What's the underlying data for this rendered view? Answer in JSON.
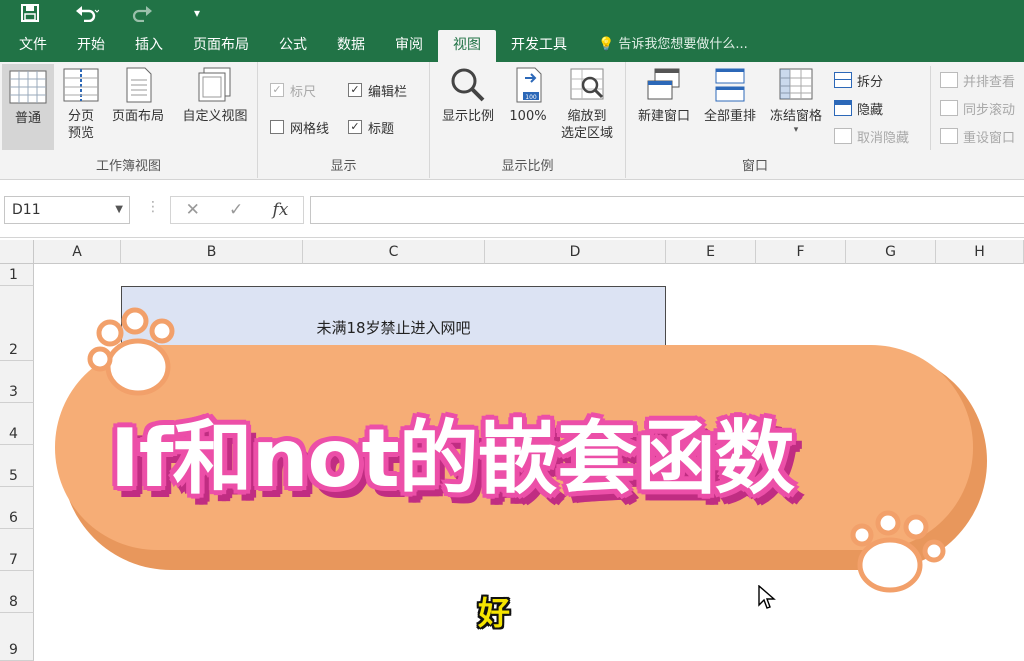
{
  "quick_access": {
    "save_icon": "save-icon",
    "undo_icon": "undo-icon",
    "redo_icon": "redo-icon",
    "customize_icon": "customize-icon"
  },
  "tabs": [
    {
      "label": "文件",
      "active": false
    },
    {
      "label": "开始",
      "active": false
    },
    {
      "label": "插入",
      "active": false
    },
    {
      "label": "页面布局",
      "active": false
    },
    {
      "label": "公式",
      "active": false
    },
    {
      "label": "数据",
      "active": false
    },
    {
      "label": "审阅",
      "active": false
    },
    {
      "label": "视图",
      "active": true
    },
    {
      "label": "开发工具",
      "active": false
    }
  ],
  "tell_me": "告诉我您想要做什么...",
  "ribbon": {
    "workbook_views": {
      "label": "工作簿视图",
      "normal": "普通",
      "page_break_1": "分页",
      "page_break_2": "预览",
      "page_layout": "页面布局",
      "custom_views": "自定义视图"
    },
    "show": {
      "label": "显示",
      "ruler": "标尺",
      "formula_bar": "编辑栏",
      "gridlines": "网格线",
      "headings": "标题"
    },
    "zoom": {
      "label": "显示比例",
      "zoom": "显示比例",
      "zoom_100": "100%",
      "zoom_sel_1": "缩放到",
      "zoom_sel_2": "选定区域",
      "badge": "100"
    },
    "window": {
      "label": "窗口",
      "new_window": "新建窗口",
      "arrange_all": "全部重排",
      "freeze_panes": "冻结窗格",
      "split": "拆分",
      "hide": "隐藏",
      "unhide": "取消隐藏",
      "side_by_side": "并排查看",
      "sync_scroll": "同步滚动",
      "reset_position": "重设窗口"
    }
  },
  "formula_bar": {
    "name_box": "D11",
    "cancel": "✕",
    "enter": "✓",
    "fx": "fx",
    "formula": ""
  },
  "columns": [
    "A",
    "B",
    "C",
    "D",
    "E",
    "F",
    "G",
    "H"
  ],
  "rows": [
    "1",
    "2",
    "3",
    "4",
    "5",
    "6",
    "7",
    "8",
    "9"
  ],
  "cells": {
    "merged_text": "未满18岁禁止进入网吧"
  },
  "overlay": {
    "title": "If和not的嵌套函数",
    "subtitle": "好"
  },
  "colors": {
    "brand": "#217346",
    "banner": "#f6ad76",
    "title_outline": "#ec4fa8",
    "subtitle": "#f5e400",
    "cell_fill": "#dce3f3"
  }
}
